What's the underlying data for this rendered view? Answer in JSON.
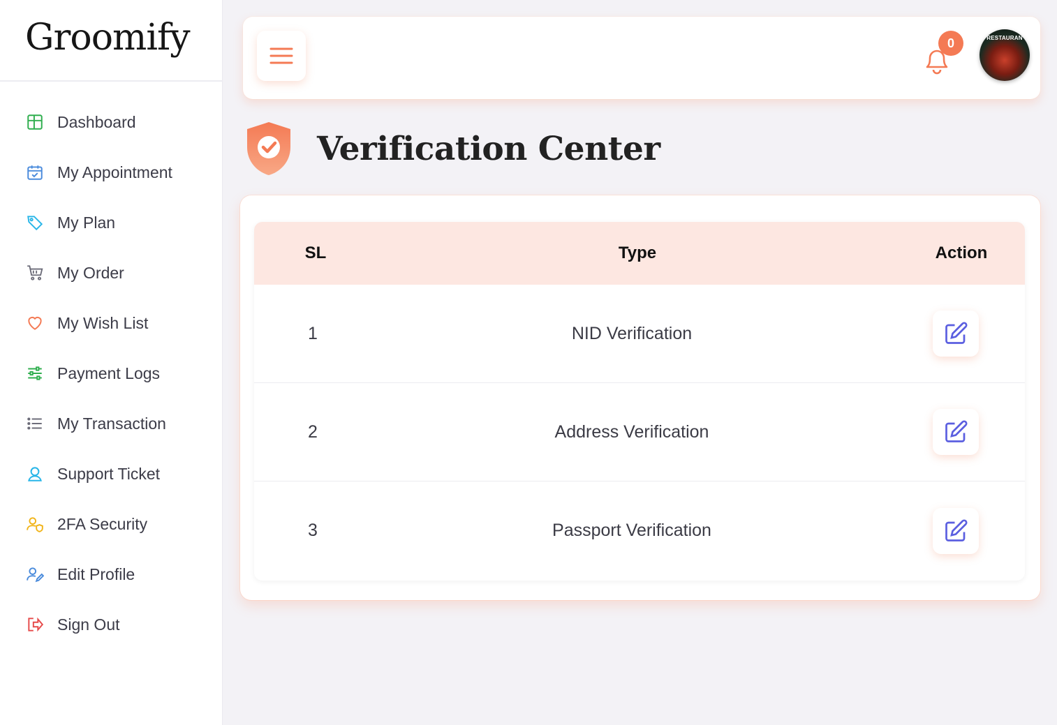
{
  "sidebar": {
    "logo": "Groomify",
    "items": [
      {
        "label": "Dashboard",
        "icon": "dashboard-icon",
        "color": "#2fae4e"
      },
      {
        "label": "My Appointment",
        "icon": "calendar-icon",
        "color": "#4a8bdc"
      },
      {
        "label": "My Plan",
        "icon": "tag-icon",
        "color": "#29b6e8"
      },
      {
        "label": "My Order",
        "icon": "cart-icon",
        "color": "#6b6b78"
      },
      {
        "label": "My Wish List",
        "icon": "heart-icon",
        "color": "#f47a54"
      },
      {
        "label": "Payment Logs",
        "icon": "sliders-icon",
        "color": "#2fae4e"
      },
      {
        "label": "My Transaction",
        "icon": "list-icon",
        "color": "#6b6b78"
      },
      {
        "label": "Support Ticket",
        "icon": "support-user-icon",
        "color": "#29b6e8"
      },
      {
        "label": "2FA Security",
        "icon": "user-shield-icon",
        "color": "#f1b419"
      },
      {
        "label": "Edit Profile",
        "icon": "user-edit-icon",
        "color": "#4a8bdc"
      },
      {
        "label": "Sign Out",
        "icon": "sign-out-icon",
        "color": "#e64b4b"
      }
    ]
  },
  "header": {
    "notification_count": "0",
    "avatar_text": "RESTAURAN"
  },
  "page": {
    "title": "Verification Center"
  },
  "table": {
    "columns": [
      "SL",
      "Type",
      "Action"
    ],
    "rows": [
      {
        "sl": "1",
        "type": "NID Verification"
      },
      {
        "sl": "2",
        "type": "Address Verification"
      },
      {
        "sl": "3",
        "type": "Passport Verification"
      }
    ]
  },
  "colors": {
    "accent": "#f47a54",
    "header_row": "#fde7e1",
    "edit_icon": "#5b5fe0"
  }
}
